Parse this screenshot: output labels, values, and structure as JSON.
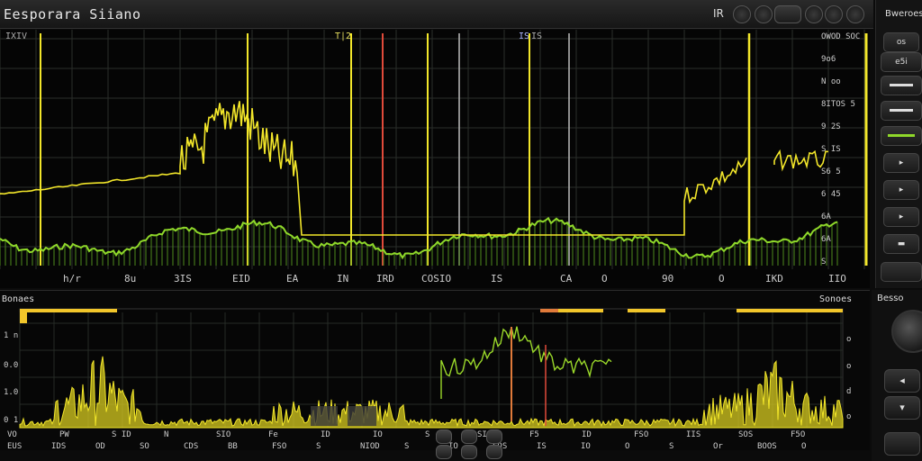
{
  "window": {
    "title": "Eesporara Siiano",
    "status_label": "IR"
  },
  "side_panel": {
    "title": "Bweroes",
    "buttons": [
      "os",
      "e5i",
      "",
      "",
      "",
      "",
      "",
      "",
      "",
      ""
    ]
  },
  "top_scope": {
    "tick_top": [
      "IXIV",
      "T|2",
      "IS",
      "IS"
    ],
    "right_scale": [
      "OWOD SOC",
      "9o6",
      "N oo",
      "8ITOS 5",
      "9 2S",
      "S IS",
      "S6 5",
      "6 45",
      "6A",
      "6A",
      "S"
    ],
    "bottom_labels": [
      "h/r",
      "8u",
      "3IS",
      "EID",
      "EA",
      "IN",
      "IRD",
      "COSIO",
      "IS",
      "CA",
      "O",
      "90",
      "O",
      "IKD",
      "IIO"
    ]
  },
  "bottom_scope": {
    "title": "Bonaes",
    "right_title": "Sonoes",
    "left_scale": [
      "1 n",
      "0.0",
      "1.0",
      "0 1"
    ],
    "right_scale": [
      "o",
      "o",
      "d",
      "o"
    ],
    "bottom_row1": [
      "VO",
      "PW",
      "S ID",
      "N",
      "SIO",
      "Fe",
      "ID",
      "IO",
      "S",
      "SIO",
      "F5",
      "ID",
      "FSO",
      "IIS",
      "SOS",
      "F5O"
    ],
    "bottom_row2": [
      "EUS",
      "IDS",
      "OD",
      "SO",
      "CDS",
      "BB",
      "FSO",
      "S",
      "NIOD",
      "S",
      "IO",
      "EOS",
      "IS",
      "IO",
      "O",
      "S",
      "Or",
      "BOOS",
      "O"
    ]
  },
  "bottom_panel": {
    "title": "Besso"
  },
  "colors": {
    "trace_yellow": "#f2e62a",
    "trace_green": "#8fd82a",
    "marker_red": "#e04a3a",
    "grid": "#2a2f2a",
    "background": "#050505"
  }
}
